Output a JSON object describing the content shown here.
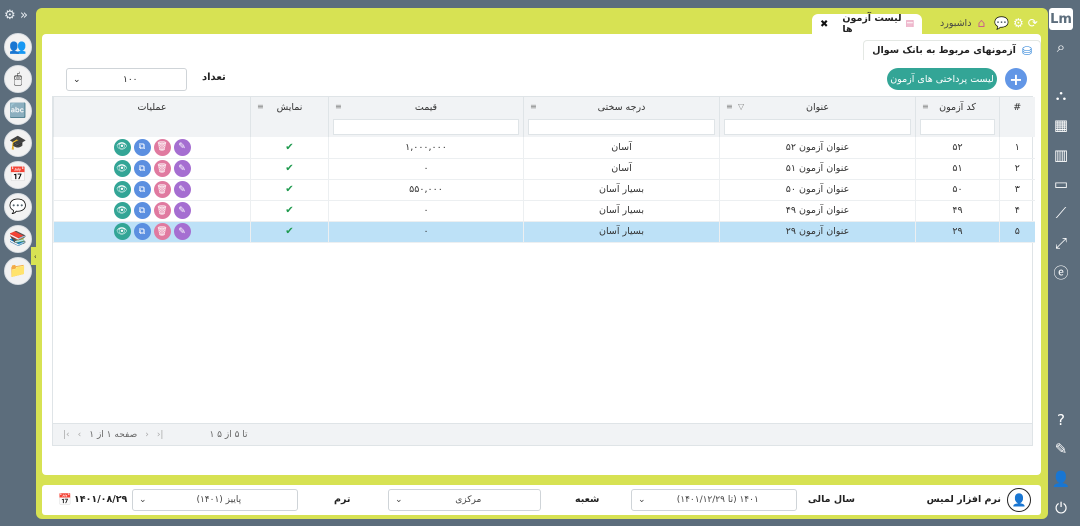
{
  "window": {
    "active_tab": "لیست آزمون ها",
    "home_tab": "داشبورد"
  },
  "page": {
    "title": "آزمونهای مربوط به بانک سوال",
    "pay_list_button": "لیست پرداختی های آزمون",
    "add_button": "+",
    "count_label": "تعداد",
    "count_value": "۱۰۰"
  },
  "table": {
    "columns": {
      "index": "#",
      "code": "کد آزمون",
      "title": "عنوان",
      "difficulty": "درجه سختی",
      "price": "قیمت",
      "display": "نمایش",
      "actions": "عملیات"
    },
    "rows": [
      {
        "index": "۱",
        "code": "۵۲",
        "title": "عنوان آزمون ۵۲",
        "difficulty": "آسان",
        "price": "۱,۰۰۰,۰۰۰",
        "display": "✔"
      },
      {
        "index": "۲",
        "code": "۵۱",
        "title": "عنوان آزمون ۵۱",
        "difficulty": "آسان",
        "price": "۰",
        "display": "✔"
      },
      {
        "index": "۳",
        "code": "۵۰",
        "title": "عنوان آزمون ۵۰",
        "difficulty": "بسیار آسان",
        "price": "۵۵۰,۰۰۰",
        "display": "✔"
      },
      {
        "index": "۴",
        "code": "۴۹",
        "title": "عنوان آزمون ۴۹",
        "difficulty": "بسیار آسان",
        "price": "۰",
        "display": "✔"
      },
      {
        "index": "۵",
        "code": "۲۹",
        "title": "عنوان آزمون ۲۹",
        "difficulty": "بسیار آسان",
        "price": "۰",
        "display": "✔"
      }
    ],
    "selected_row": 4
  },
  "pagination": {
    "range_text": "۱ تا ۵ از ۵",
    "page_text": "صفحه ۱ از ۱"
  },
  "footer": {
    "user_name": "نرم افزار لمیس",
    "fiscal_year_label": "سال مالی",
    "fiscal_year_value": "(تا ۱۴۰۱/۱۲/۲۹) ۱۴۰۱",
    "branch_label": "شعبه",
    "branch_value": "مرکزی",
    "term_label": "ترم",
    "term_value": "پاییز (۱۴۰۱)",
    "date": "۱۴۰۱/۰۸/۲۹"
  },
  "colors": {
    "frame": "#d7e253",
    "sidebar": "#5c6d7c",
    "accent_teal": "#33a596",
    "accent_blue": "#6296e6",
    "selected_row": "#bde1f7"
  }
}
